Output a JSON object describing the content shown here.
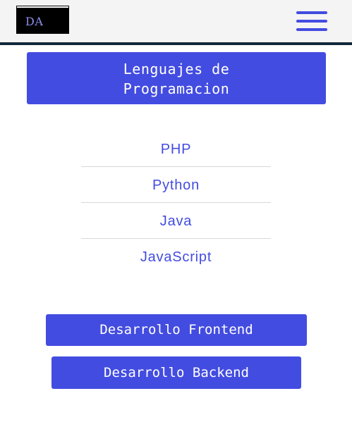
{
  "header": {
    "logo_text": "DA",
    "menu_icon": "hamburger-menu-icon"
  },
  "main": {
    "title_line1": "Lenguajes de",
    "title_line2": "Programacion",
    "languages": [
      "PHP",
      "Python",
      "Java",
      "JavaScript"
    ],
    "frontend_label": "Desarrollo Frontend",
    "backend_label": "Desarrollo Backend"
  },
  "colors": {
    "accent": "#434ce0",
    "header_bg": "#f4f4f4",
    "header_border": "#12283a",
    "logo_bg": "#000000",
    "logo_text": "#8b8ef0"
  }
}
